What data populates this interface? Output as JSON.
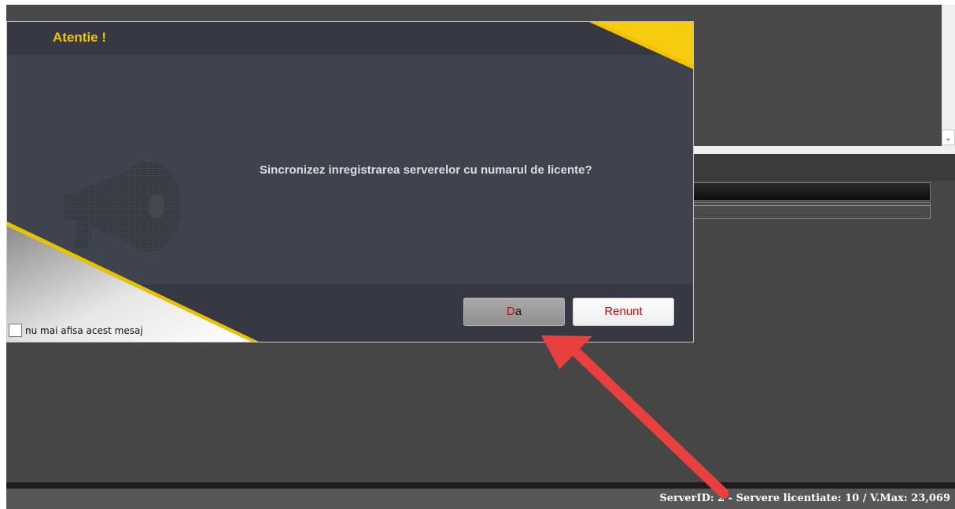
{
  "dialog": {
    "title": "Atentie !",
    "message": "Sincronizez inregistrarea serverelor cu numarul de licente?",
    "yes_button": {
      "accel": "D",
      "rest": "a"
    },
    "cancel_button": "Renunt",
    "checkbox_label": "nu mai afisa acest mesaj",
    "checkbox_checked": false,
    "accent_color": "#f5c400",
    "icon": "megaphone-icon"
  },
  "background_app": {
    "scroll_arrow_glyph": "⌄"
  },
  "status_bar": {
    "text": "ServerID: 2 -  Servere licentiate: 10 / V.Max: 23,069"
  },
  "annotation": {
    "type": "arrow",
    "color": "#e8403f",
    "points_to": "yes-button"
  }
}
